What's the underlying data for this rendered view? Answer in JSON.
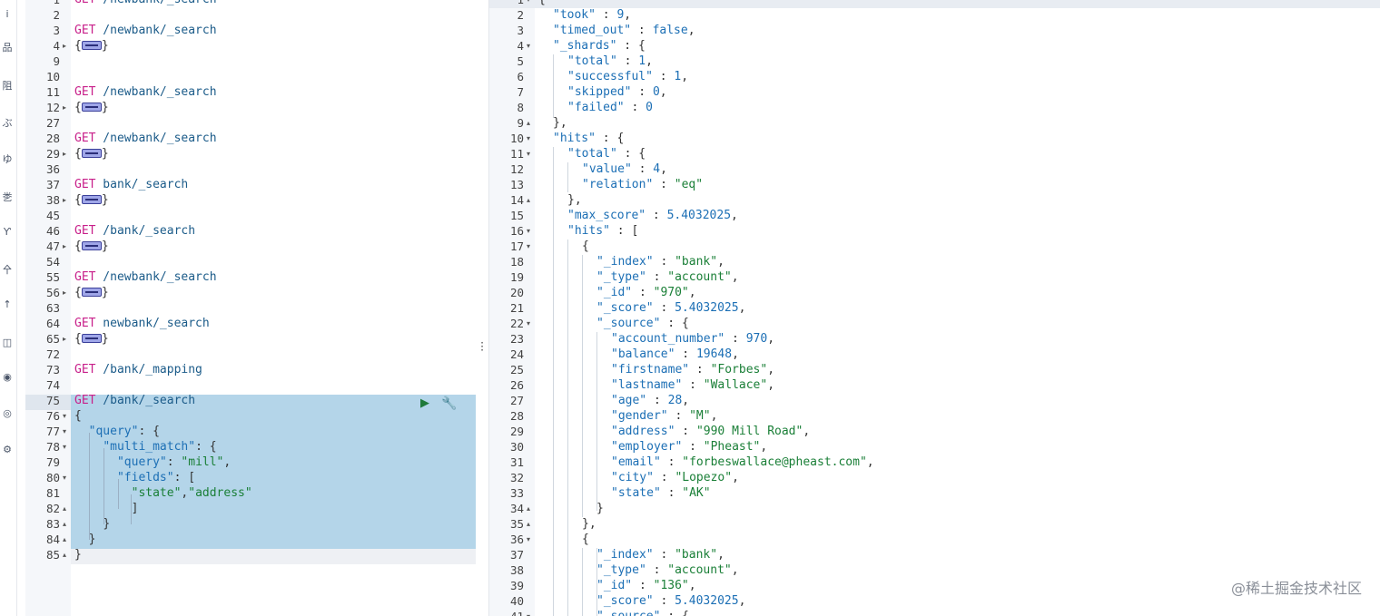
{
  "rail": {
    "icons": [
      "i",
      "品",
      "阻",
      "ぶ",
      "ゆ",
      "㐘",
      "Ƴ",
      "㐃",
      "↑",
      "◫",
      "◉",
      "◎",
      "⚙"
    ]
  },
  "editor": {
    "requests": [
      {
        "num": "1",
        "method": "GET",
        "path": " /newbank/_search"
      },
      {
        "num": "2",
        "blank": true
      },
      {
        "num": "3",
        "method": "GET",
        "path": " /newbank/_search"
      },
      {
        "num": "4",
        "fold": "▸",
        "collapsed": true
      },
      {
        "num": "9",
        "blank": true
      },
      {
        "num": "10",
        "blank": true
      },
      {
        "num": "11",
        "method": "GET",
        "path": " /newbank/_search"
      },
      {
        "num": "12",
        "fold": "▸",
        "collapsed": true
      },
      {
        "num": "27",
        "blank": true
      },
      {
        "num": "28",
        "method": "GET",
        "path": " /newbank/_search"
      },
      {
        "num": "29",
        "fold": "▸",
        "collapsed": true
      },
      {
        "num": "36",
        "blank": true
      },
      {
        "num": "37",
        "method": "GET",
        "path": " bank/_search"
      },
      {
        "num": "38",
        "fold": "▸",
        "collapsed": true
      },
      {
        "num": "45",
        "blank": true
      },
      {
        "num": "46",
        "method": "GET",
        "path": " /bank/_search"
      },
      {
        "num": "47",
        "fold": "▸",
        "collapsed": true
      },
      {
        "num": "54",
        "blank": true
      },
      {
        "num": "55",
        "method": "GET",
        "path": " /newbank/_search"
      },
      {
        "num": "56",
        "fold": "▸",
        "collapsed": true
      },
      {
        "num": "63",
        "blank": true
      },
      {
        "num": "64",
        "method": "GET",
        "path": " newbank/_search"
      },
      {
        "num": "65",
        "fold": "▸",
        "collapsed": true
      },
      {
        "num": "72",
        "blank": true
      },
      {
        "num": "73",
        "method": "GET",
        "path": " /bank/_mapping"
      },
      {
        "num": "74",
        "blank": true
      }
    ],
    "active_request": {
      "method": "GET",
      "path": " /bank/_search",
      "lines": [
        {
          "num": "75",
          "text": ""
        },
        {
          "num": "76",
          "fold": "▾",
          "text": "{"
        },
        {
          "num": "77",
          "fold": "▾",
          "indent": "  ",
          "key": "\"query\"",
          "rest": ": {"
        },
        {
          "num": "78",
          "fold": "▾",
          "indent": "    ",
          "key": "\"multi_match\"",
          "rest": ": {"
        },
        {
          "num": "79",
          "indent": "      ",
          "key": "\"query\"",
          "rest": ": ",
          "str": "\"mill\"",
          "tail": ","
        },
        {
          "num": "80",
          "fold": "▾",
          "indent": "      ",
          "key": "\"fields\"",
          "rest": ": ["
        },
        {
          "num": "81",
          "indent": "        ",
          "str": "\"state\"",
          "tail": ",",
          "str2": "\"address\""
        },
        {
          "num": "82",
          "fold": "▴",
          "indent": "        ",
          "text": "]"
        },
        {
          "num": "83",
          "fold": "▴",
          "indent": "    ",
          "text": "}"
        },
        {
          "num": "84",
          "fold": "▴",
          "indent": "  ",
          "text": "}"
        },
        {
          "num": "85",
          "fold": "▴",
          "text": "}"
        }
      ]
    },
    "run_icon": "play-icon",
    "wrench_icon": "wrench-icon"
  },
  "output": {
    "lines": [
      {
        "num": "1",
        "fold": "▾",
        "text": "{"
      },
      {
        "num": "2",
        "i": 1,
        "k": "\"took\"",
        "v": "9",
        "vt": "n",
        "t": ","
      },
      {
        "num": "3",
        "i": 1,
        "k": "\"timed_out\"",
        "v": "false",
        "vt": "b",
        "t": ","
      },
      {
        "num": "4",
        "fold": "▾",
        "i": 1,
        "k": "\"_shards\"",
        "o": "{"
      },
      {
        "num": "5",
        "i": 2,
        "k": "\"total\"",
        "v": "1",
        "vt": "n",
        "t": ","
      },
      {
        "num": "6",
        "i": 2,
        "k": "\"successful\"",
        "v": "1",
        "vt": "n",
        "t": ","
      },
      {
        "num": "7",
        "i": 2,
        "k": "\"skipped\"",
        "v": "0",
        "vt": "n",
        "t": ","
      },
      {
        "num": "8",
        "i": 2,
        "k": "\"failed\"",
        "v": "0",
        "vt": "n",
        "t": ""
      },
      {
        "num": "9",
        "fold": "▴",
        "i": 1,
        "text": "},"
      },
      {
        "num": "10",
        "fold": "▾",
        "i": 1,
        "k": "\"hits\"",
        "o": "{"
      },
      {
        "num": "11",
        "fold": "▾",
        "i": 2,
        "k": "\"total\"",
        "o": "{"
      },
      {
        "num": "12",
        "i": 3,
        "k": "\"value\"",
        "v": "4",
        "vt": "n",
        "t": ","
      },
      {
        "num": "13",
        "i": 3,
        "k": "\"relation\"",
        "v": "\"eq\"",
        "vt": "s",
        "t": ""
      },
      {
        "num": "14",
        "fold": "▴",
        "i": 2,
        "text": "},"
      },
      {
        "num": "15",
        "i": 2,
        "k": "\"max_score\"",
        "v": "5.4032025",
        "vt": "n",
        "t": ","
      },
      {
        "num": "16",
        "fold": "▾",
        "i": 2,
        "k": "\"hits\"",
        "o": "["
      },
      {
        "num": "17",
        "fold": "▾",
        "i": 3,
        "text": "{"
      },
      {
        "num": "18",
        "i": 4,
        "k": "\"_index\"",
        "v": "\"bank\"",
        "vt": "s",
        "t": ","
      },
      {
        "num": "19",
        "i": 4,
        "k": "\"_type\"",
        "v": "\"account\"",
        "vt": "s",
        "t": ","
      },
      {
        "num": "20",
        "i": 4,
        "k": "\"_id\"",
        "v": "\"970\"",
        "vt": "s",
        "t": ","
      },
      {
        "num": "21",
        "i": 4,
        "k": "\"_score\"",
        "v": "5.4032025",
        "vt": "n",
        "t": ","
      },
      {
        "num": "22",
        "fold": "▾",
        "i": 4,
        "k": "\"_source\"",
        "o": "{"
      },
      {
        "num": "23",
        "i": 5,
        "k": "\"account_number\"",
        "v": "970",
        "vt": "n",
        "t": ","
      },
      {
        "num": "24",
        "i": 5,
        "k": "\"balance\"",
        "v": "19648",
        "vt": "n",
        "t": ","
      },
      {
        "num": "25",
        "i": 5,
        "k": "\"firstname\"",
        "v": "\"Forbes\"",
        "vt": "s",
        "t": ","
      },
      {
        "num": "26",
        "i": 5,
        "k": "\"lastname\"",
        "v": "\"Wallace\"",
        "vt": "s",
        "t": ","
      },
      {
        "num": "27",
        "i": 5,
        "k": "\"age\"",
        "v": "28",
        "vt": "n",
        "t": ","
      },
      {
        "num": "28",
        "i": 5,
        "k": "\"gender\"",
        "v": "\"M\"",
        "vt": "s",
        "t": ","
      },
      {
        "num": "29",
        "i": 5,
        "k": "\"address\"",
        "v": "\"990 Mill Road\"",
        "vt": "s",
        "t": ","
      },
      {
        "num": "30",
        "i": 5,
        "k": "\"employer\"",
        "v": "\"Pheast\"",
        "vt": "s",
        "t": ","
      },
      {
        "num": "31",
        "i": 5,
        "k": "\"email\"",
        "v": "\"forbeswallace@pheast.com\"",
        "vt": "s",
        "t": ","
      },
      {
        "num": "32",
        "i": 5,
        "k": "\"city\"",
        "v": "\"Lopezo\"",
        "vt": "s",
        "t": ","
      },
      {
        "num": "33",
        "i": 5,
        "k": "\"state\"",
        "v": "\"AK\"",
        "vt": "s",
        "t": ""
      },
      {
        "num": "34",
        "fold": "▴",
        "i": 4,
        "text": "}"
      },
      {
        "num": "35",
        "fold": "▴",
        "i": 3,
        "text": "},"
      },
      {
        "num": "36",
        "fold": "▾",
        "i": 3,
        "text": "{"
      },
      {
        "num": "37",
        "i": 4,
        "k": "\"_index\"",
        "v": "\"bank\"",
        "vt": "s",
        "t": ","
      },
      {
        "num": "38",
        "i": 4,
        "k": "\"_type\"",
        "v": "\"account\"",
        "vt": "s",
        "t": ","
      },
      {
        "num": "39",
        "i": 4,
        "k": "\"_id\"",
        "v": "\"136\"",
        "vt": "s",
        "t": ","
      },
      {
        "num": "40",
        "i": 4,
        "k": "\"_score\"",
        "v": "5.4032025",
        "vt": "n",
        "t": ","
      },
      {
        "num": "41",
        "fold": "▾",
        "i": 4,
        "k": "\"_source\"",
        "o": "{"
      }
    ]
  },
  "watermark": "@稀土掘金技术社区",
  "colors": {
    "method": "#c81f8a",
    "key": "#1c6fb5",
    "string": "#1a7f37",
    "selection": "#b4d5e9",
    "gutter": "#f5f7fa"
  }
}
